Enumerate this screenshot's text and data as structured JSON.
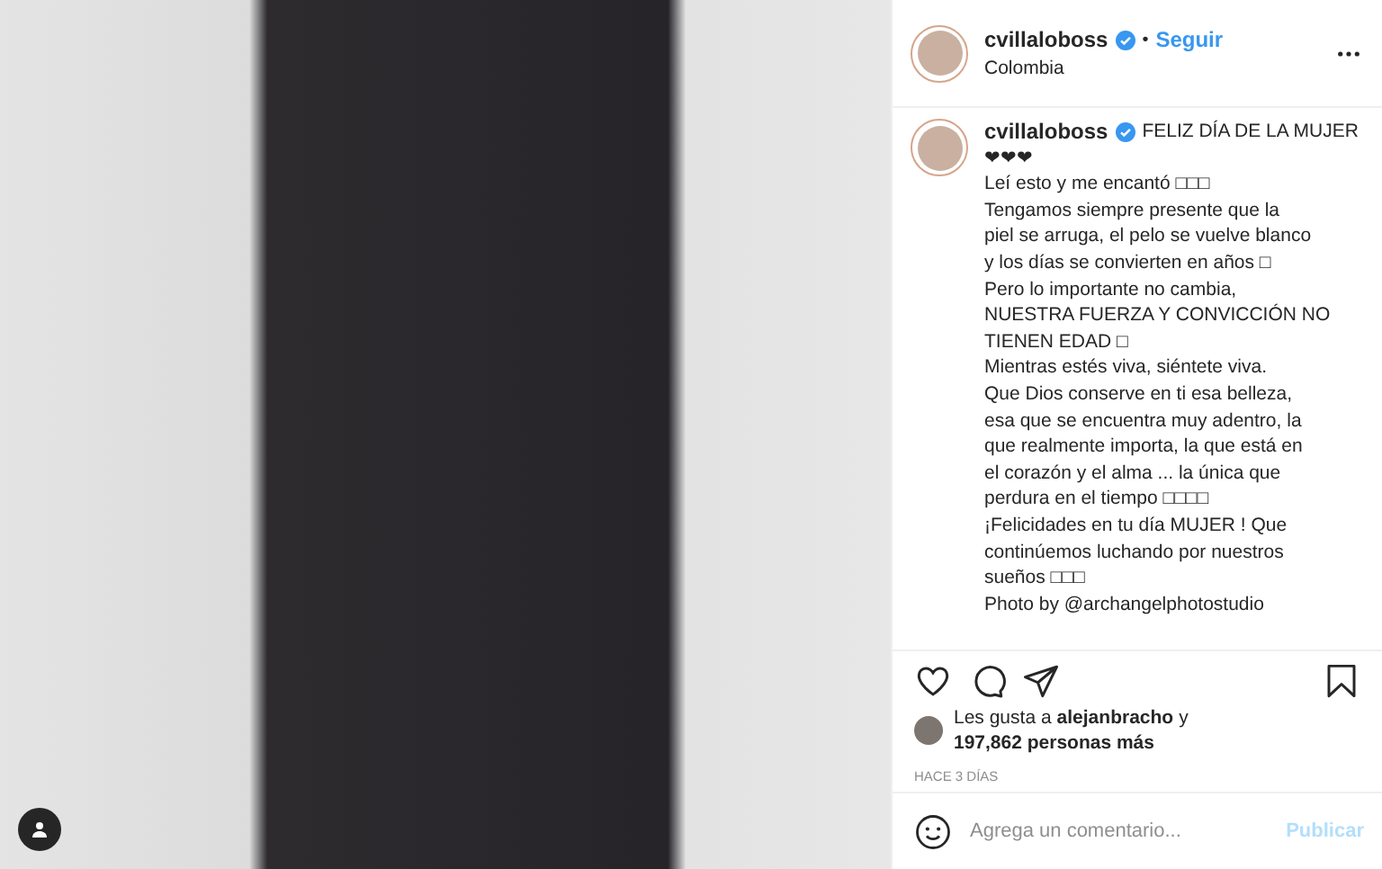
{
  "post": {
    "photo": {
      "user_tags": true
    }
  },
  "header": {
    "username": "cvillaloboss",
    "verified": true,
    "separator": "•",
    "follow": "Seguir",
    "location": "Colombia"
  },
  "caption": {
    "username": "cvillaloboss",
    "verified": true,
    "lines": [
      "FELIZ DÍA DE LA MUJER",
      "❤❤❤",
      "Leí esto y me encantó □□□",
      "Tengamos siempre presente que la",
      "piel se arruga, el pelo se vuelve blanco",
      "y los días se convierten en años □",
      "Pero lo importante no cambia,",
      "NUESTRA FUERZA Y CONVICCIÓN NO",
      "TIENEN EDAD □",
      "Mientras estés viva, siéntete viva.",
      "Que Dios conserve en ti esa belleza,",
      "esa que se encuentra muy adentro, la",
      "que realmente importa, la que está en",
      "el corazón y el alma ... la única que",
      "perdura en el tiempo □□□□",
      "¡Felicidades en tu día MUJER ! Que",
      "continúemos luchando por nuestros",
      "sueños □□□",
      "Photo by @archangelphotostudio"
    ]
  },
  "likes": {
    "prefix": "Les gusta a",
    "user": "alejanbracho",
    "suffix": "y",
    "count": "197,862 personas más"
  },
  "time": "HACE 3 DÍAS",
  "comment": {
    "placeholder": "Agrega un comentario...",
    "button": "Publicar",
    "disabled": true
  }
}
